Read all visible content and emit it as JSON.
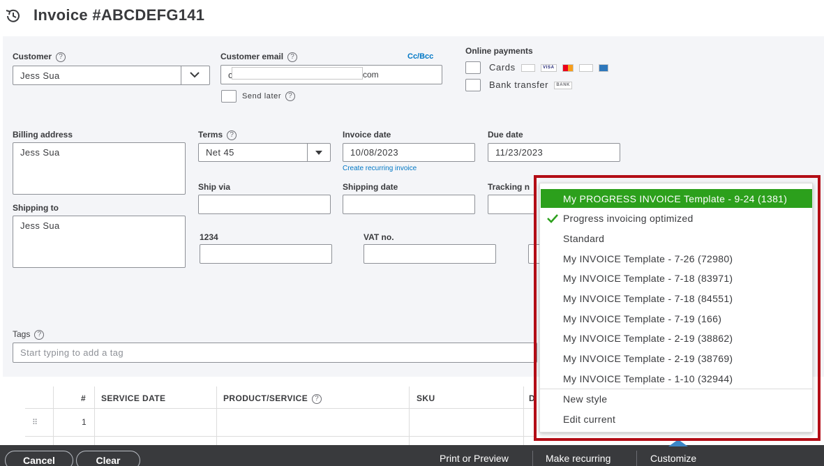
{
  "header": {
    "title": "Invoice #ABCDEFG141"
  },
  "customer": {
    "label": "Customer",
    "help": "?",
    "value": "Jess Sua"
  },
  "email": {
    "label": "Customer email",
    "help": "?",
    "cc_bcc": "Cc/Bcc",
    "value_start": "c",
    "value_end": "com",
    "send_later": "Send later"
  },
  "online_payments": {
    "label": "Online payments",
    "cards": "Cards",
    "bank_transfer": "Bank transfer",
    "card_logos": [
      "VISA",
      "BANK"
    ]
  },
  "billing": {
    "label": "Billing address",
    "value": "Jess Sua"
  },
  "terms": {
    "label": "Terms",
    "help": "?",
    "value": "Net 45"
  },
  "invoice_date": {
    "label": "Invoice date",
    "value": "10/08/2023",
    "recurring_link": "Create recurring invoice"
  },
  "due_date": {
    "label": "Due date",
    "value": "11/23/2023"
  },
  "ship_via": {
    "label": "Ship via"
  },
  "shipping_date": {
    "label": "Shipping date"
  },
  "tracking": {
    "label": "Tracking n"
  },
  "shipping_to": {
    "label": "Shipping to",
    "value": "Jess Sua"
  },
  "custom_1234": {
    "label": "1234"
  },
  "vat": {
    "label": "VAT no."
  },
  "tags": {
    "label": "Tags",
    "help": "?",
    "placeholder": "Start typing to add a tag"
  },
  "table": {
    "columns": [
      "#",
      "SERVICE DATE",
      "PRODUCT/SERVICE",
      "SKU"
    ],
    "row_number": "1"
  },
  "footer": {
    "cancel": "Cancel",
    "clear": "Clear",
    "print_preview": "Print or Preview",
    "make_recurring": "Make recurring",
    "customize": "Customize"
  },
  "customize_menu": {
    "selected": "My PROGRESS INVOICE Template - 9-24 (1381)",
    "checked_item": "Progress invoicing optimized",
    "items": [
      "Standard",
      "My INVOICE Template - 7-26 (72980)",
      "My INVOICE Template - 7-18 (83971)",
      "My INVOICE Template - 7-18 (84551)",
      "My INVOICE Template - 7-19 (166)",
      "My INVOICE Template - 2-19 (38862)",
      "My INVOICE Template - 2-19 (38769)",
      "My INVOICE Template - 1-10 (32944)"
    ],
    "new_style": "New style",
    "edit_current": "Edit current"
  },
  "colors": {
    "accent_green": "#2ca01c",
    "highlight_red": "#b30d16",
    "link_blue": "#0077c5",
    "footer_dark": "#393a3d"
  }
}
